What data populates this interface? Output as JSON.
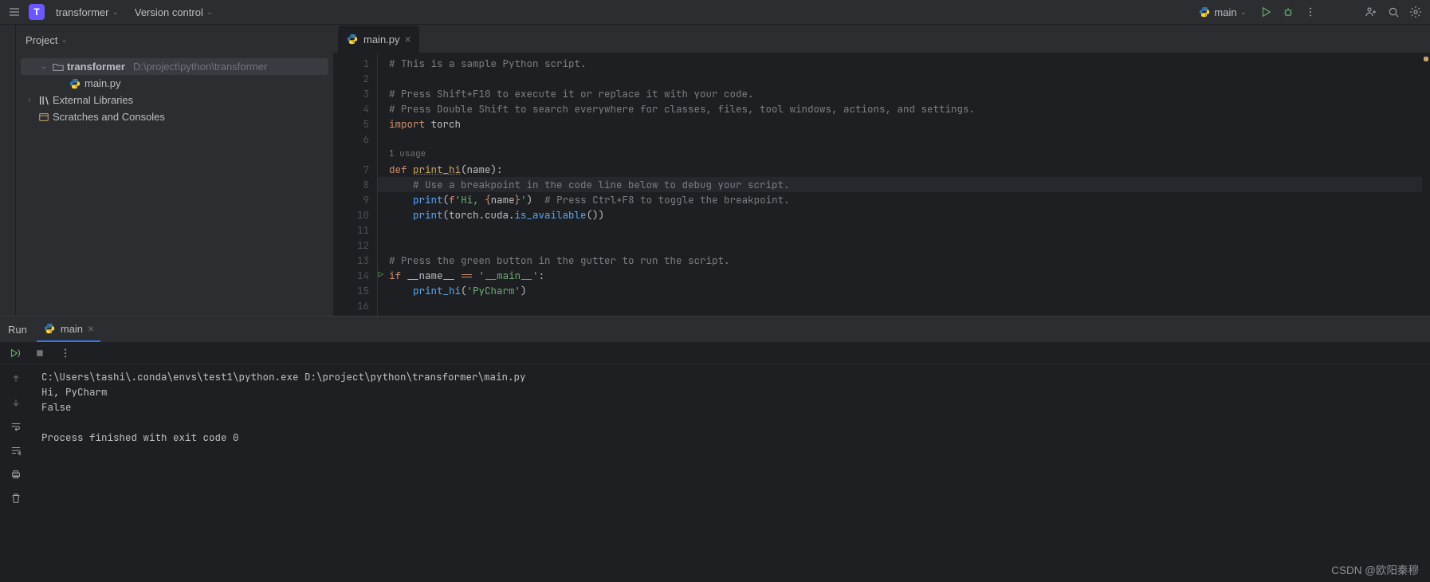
{
  "topbar": {
    "project_letter": "T",
    "project_name": "transformer",
    "vc_label": "Version control",
    "run_config": "main"
  },
  "sidebar": {
    "title": "Project",
    "root": {
      "name": "transformer",
      "path": "D:\\project\\python\\transformer"
    },
    "file": "main.py",
    "external": "External Libraries",
    "scratches": "Scratches and Consoles"
  },
  "editor": {
    "tab_name": "main.py",
    "usage_label": "1 usage",
    "lines": [
      {
        "n": 1,
        "tokens": [
          [
            "comment",
            "# This is a sample Python script."
          ]
        ]
      },
      {
        "n": 2,
        "tokens": []
      },
      {
        "n": 3,
        "tokens": [
          [
            "comment",
            "# Press Shift+F10 to execute it or replace it with your code."
          ]
        ]
      },
      {
        "n": 4,
        "tokens": [
          [
            "comment",
            "# Press Double Shift to search everywhere for classes, files, tool windows, actions, and settings."
          ]
        ]
      },
      {
        "n": 5,
        "tokens": [
          [
            "kw",
            "import"
          ],
          [
            "id",
            " torch"
          ]
        ]
      },
      {
        "n": 6,
        "tokens": []
      },
      {
        "n": 7,
        "tokens": [
          [
            "kw",
            "def "
          ],
          [
            "fnd",
            "print_hi"
          ],
          [
            "id",
            "(name):"
          ]
        ]
      },
      {
        "n": 8,
        "hl": true,
        "tokens": [
          [
            "id",
            "    "
          ],
          [
            "comment",
            "# Use a breakpoint in the code line below to debug your script."
          ]
        ]
      },
      {
        "n": 9,
        "tokens": [
          [
            "id",
            "    "
          ],
          [
            "fn",
            "print"
          ],
          [
            "id",
            "("
          ],
          [
            "kw",
            "f"
          ],
          [
            "str",
            "'Hi, "
          ],
          [
            "brace",
            "{"
          ],
          [
            "id",
            "name"
          ],
          [
            "brace",
            "}"
          ],
          [
            "str",
            "'"
          ],
          [
            "id",
            ")  "
          ],
          [
            "comment",
            "# Press Ctrl+F8 to toggle the breakpoint."
          ]
        ]
      },
      {
        "n": 10,
        "tokens": [
          [
            "id",
            "    "
          ],
          [
            "fn",
            "print"
          ],
          [
            "id",
            "(torch.cuda."
          ],
          [
            "fn",
            "is_available"
          ],
          [
            "id",
            "())"
          ]
        ]
      },
      {
        "n": 11,
        "tokens": []
      },
      {
        "n": 12,
        "tokens": []
      },
      {
        "n": 13,
        "tokens": [
          [
            "comment",
            "# Press the green button in the gutter to run the script."
          ]
        ]
      },
      {
        "n": 14,
        "run_marker": true,
        "tokens": [
          [
            "kw",
            "if"
          ],
          [
            "id",
            " __name__ "
          ],
          [
            "kw",
            "=="
          ],
          [
            "id",
            " "
          ],
          [
            "str",
            "'__main__'"
          ],
          [
            "id",
            ":"
          ]
        ]
      },
      {
        "n": 15,
        "tokens": [
          [
            "id",
            "    "
          ],
          [
            "fn",
            "print_hi"
          ],
          [
            "id",
            "("
          ],
          [
            "str",
            "'PyCharm'"
          ],
          [
            "id",
            ")"
          ]
        ]
      },
      {
        "n": 16,
        "tokens": []
      }
    ]
  },
  "run": {
    "label": "Run",
    "tab": "main",
    "console": "C:\\Users\\tashi\\.conda\\envs\\test1\\python.exe D:\\project\\python\\transformer\\main.py\nHi, PyCharm\nFalse\n\nProcess finished with exit code 0"
  },
  "watermark": "CSDN @欧阳秦穆"
}
